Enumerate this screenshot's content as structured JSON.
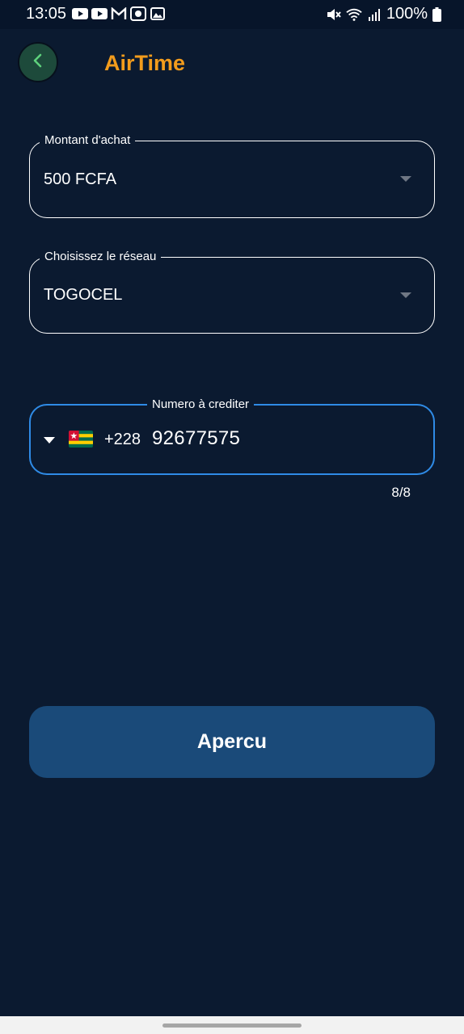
{
  "status_bar": {
    "time": "13:05",
    "battery": "100%",
    "left_icons": [
      "youtube-icon",
      "youtube-icon",
      "gmail-icon",
      "camera-icon",
      "gallery-icon"
    ],
    "right_icons": [
      "mute-icon",
      "wifi-icon",
      "signal-icon",
      "battery-icon"
    ]
  },
  "header": {
    "title": "AirTime",
    "title_color": "#f39c1c",
    "back_button_color": "#1d4a3b"
  },
  "form": {
    "amount": {
      "label": "Montant d'achat",
      "value": "500 FCFA"
    },
    "network": {
      "label": "Choisissez le réseau",
      "value": "TOGOCEL"
    },
    "phone": {
      "label": "Numero à crediter",
      "country_flag": "togo-flag",
      "dial_code": "+228",
      "number": "92677575",
      "counter": "8/8",
      "focus_color": "#2f8be6"
    }
  },
  "actions": {
    "preview_label": "Apercu",
    "button_color": "#1a4a79"
  },
  "colors": {
    "background": "#0b1a30"
  }
}
